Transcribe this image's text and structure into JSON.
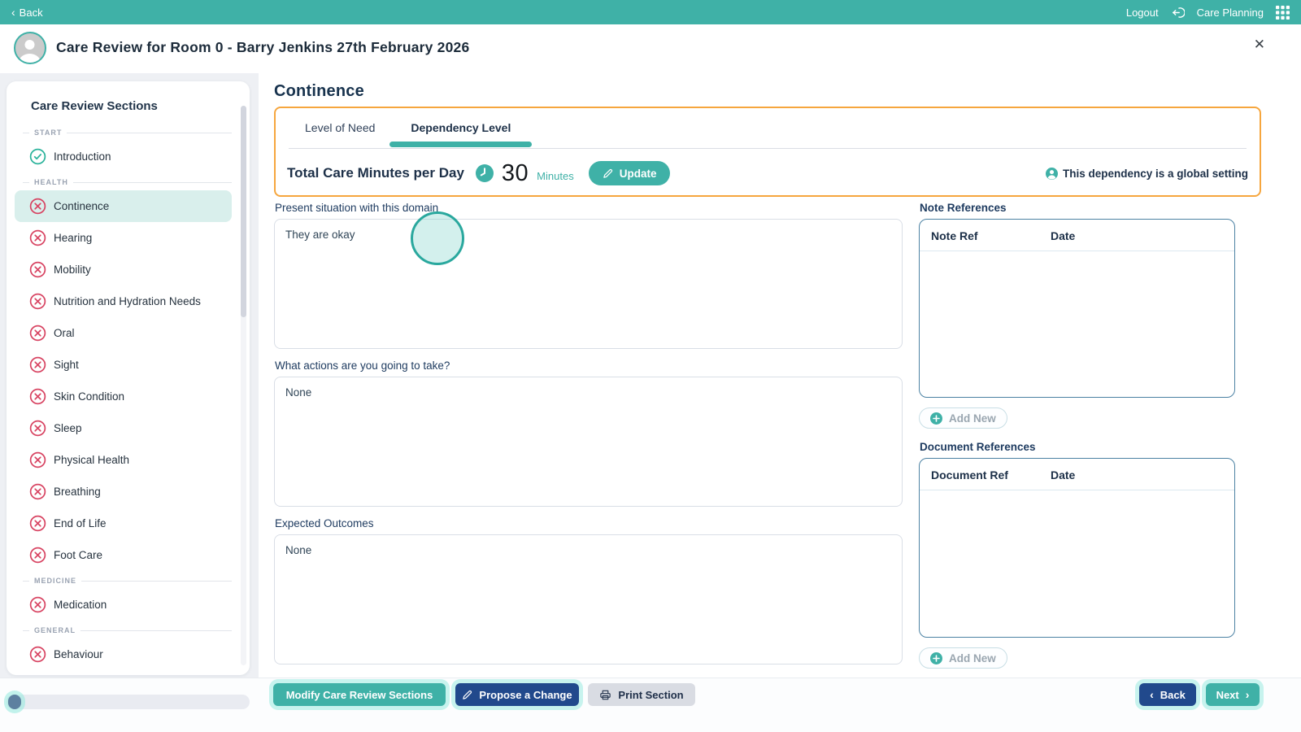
{
  "topbar": {
    "back_label": "Back",
    "logout_label": "Logout",
    "app_label": "Care Planning"
  },
  "header": {
    "title": "Care Review for Room 0 - Barry Jenkins 27th February 2026"
  },
  "sidebar": {
    "title": "Care Review Sections",
    "groups": [
      {
        "label": "START",
        "items": [
          {
            "label": "Introduction",
            "status": "done",
            "active": false
          }
        ]
      },
      {
        "label": "HEALTH",
        "items": [
          {
            "label": "Continence",
            "status": "todo",
            "active": true
          },
          {
            "label": "Hearing",
            "status": "todo",
            "active": false
          },
          {
            "label": "Mobility",
            "status": "todo",
            "active": false
          },
          {
            "label": "Nutrition and Hydration Needs",
            "status": "todo",
            "active": false
          },
          {
            "label": "Oral",
            "status": "todo",
            "active": false
          },
          {
            "label": "Sight",
            "status": "todo",
            "active": false
          },
          {
            "label": "Skin Condition",
            "status": "todo",
            "active": false
          },
          {
            "label": "Sleep",
            "status": "todo",
            "active": false
          },
          {
            "label": "Physical Health",
            "status": "todo",
            "active": false
          },
          {
            "label": "Breathing",
            "status": "todo",
            "active": false
          },
          {
            "label": "End of Life",
            "status": "todo",
            "active": false
          },
          {
            "label": "Foot Care",
            "status": "todo",
            "active": false
          }
        ]
      },
      {
        "label": "MEDICINE",
        "items": [
          {
            "label": "Medication",
            "status": "todo",
            "active": false
          }
        ]
      },
      {
        "label": "GENERAL",
        "items": [
          {
            "label": "Behaviour",
            "status": "todo",
            "active": false
          }
        ]
      }
    ],
    "status_icons": {
      "done": "check-circle-icon",
      "todo": "x-circle-icon"
    }
  },
  "main": {
    "section_title": "Continence",
    "tabs": [
      {
        "label": "Level of Need",
        "active": false
      },
      {
        "label": "Dependency Level",
        "active": true
      }
    ],
    "dependency": {
      "label": "Total Care Minutes per Day",
      "value": "30",
      "unit": "Minutes",
      "update_label": "Update",
      "global_note": "This dependency is a global setting"
    },
    "fields": [
      {
        "label": "Present situation with this domain",
        "value": "They are okay"
      },
      {
        "label": "What actions are you going to take?",
        "value": "None"
      },
      {
        "label": "Expected Outcomes",
        "value": "None"
      }
    ],
    "note_references": {
      "title": "Note References",
      "columns": [
        "Note Ref",
        "Date"
      ],
      "rows": [],
      "add_label": "Add New"
    },
    "document_references": {
      "title": "Document References",
      "columns": [
        "Document Ref",
        "Date"
      ],
      "rows": [],
      "add_label": "Add New"
    }
  },
  "footer": {
    "modify_label": "Modify Care Review Sections",
    "propose_label": "Propose a Change",
    "print_label": "Print Section",
    "back_label": "Back",
    "next_label": "Next"
  },
  "colors": {
    "accent_teal": "#3FB1A7",
    "navy_button": "#21498C",
    "crimson_incomplete": "#D84563",
    "orange_highlight": "#F6A63E",
    "active_item_bg": "#D9EFEC",
    "reference_border": "#4C82A3",
    "progress_thumb": "#5D80A0"
  }
}
